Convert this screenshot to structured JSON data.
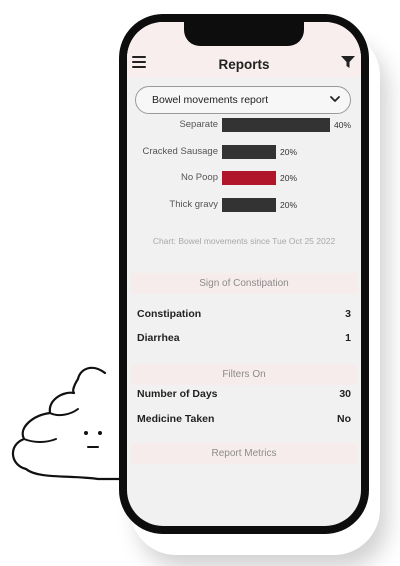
{
  "header": {
    "title": "Reports"
  },
  "report_select": {
    "selected": "Bowel movements report"
  },
  "chart_data": {
    "type": "bar",
    "orientation": "horizontal",
    "categories": [
      "Separate",
      "Cracked Sausage",
      "No Poop",
      "Thick gravy"
    ],
    "values": [
      40,
      20,
      20,
      20
    ],
    "value_labels": [
      "40%",
      "20%",
      "20%",
      "20%"
    ],
    "unit": "%",
    "xlim": [
      0,
      40
    ],
    "colors": [
      "#333333",
      "#333333",
      "#b0152a",
      "#333333"
    ],
    "caption": "Chart: Bowel movements since Tue Oct 25 2022"
  },
  "sections": {
    "constipation": {
      "title": "Sign of Constipation",
      "rows": [
        {
          "label": "Constipation",
          "value": "3"
        },
        {
          "label": "Diarrhea",
          "value": "1"
        }
      ]
    },
    "filters": {
      "title": "Filters On",
      "rows": [
        {
          "label": "Number of Days",
          "value": "30"
        },
        {
          "label": "Medicine Taken",
          "value": "No"
        }
      ]
    },
    "metrics": {
      "title": "Report Metrics"
    }
  },
  "icons": {
    "menu": "hamburger-menu-icon",
    "filter": "funnel-icon",
    "dropdown": "chevron-down-icon",
    "mascot": "poop-mascot-icon"
  }
}
